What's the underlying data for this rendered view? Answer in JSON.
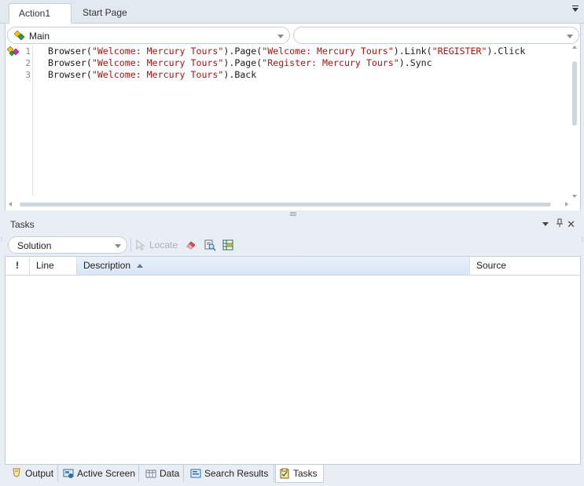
{
  "doc_tabs": [
    {
      "label": "Action1",
      "active": true
    },
    {
      "label": "Start Page",
      "active": false
    }
  ],
  "editor": {
    "scope_combo": {
      "value": "Main",
      "icon": "action-diamond-icon"
    },
    "member_combo": {
      "value": ""
    },
    "lines": [
      {
        "num": "1",
        "parts": [
          {
            "t": "Browser("
          },
          {
            "s": "\"Welcome: Mercury Tours\""
          },
          {
            "t": ").Page("
          },
          {
            "s": "\"Welcome: Mercury Tours\""
          },
          {
            "t": ").Link("
          },
          {
            "s": "\"REGISTER\""
          },
          {
            "t": ").Click"
          }
        ]
      },
      {
        "num": "2",
        "parts": [
          {
            "t": "Browser("
          },
          {
            "s": "\"Welcome: Mercury Tours\""
          },
          {
            "t": ").Page("
          },
          {
            "s": "\"Register: Mercury Tours\""
          },
          {
            "t": ").Sync"
          }
        ]
      },
      {
        "num": "3",
        "parts": [
          {
            "t": "Browser("
          },
          {
            "s": "\"Welcome: Mercury Tours\""
          },
          {
            "t": ").Back"
          }
        ]
      }
    ]
  },
  "tasks": {
    "title": "Tasks",
    "filter_value": "Solution",
    "toolbar": {
      "locate_label": "Locate"
    },
    "columns": {
      "bang": "!",
      "line": "Line",
      "description": "Description",
      "source": "Source"
    },
    "rows": []
  },
  "bottom_tabs": [
    {
      "label": "Output",
      "icon": "output-icon",
      "active": false
    },
    {
      "label": "Active Screen",
      "icon": "active-screen-icon",
      "active": false
    },
    {
      "label": "Data",
      "icon": "data-table-icon",
      "active": false
    },
    {
      "label": "Search Results",
      "icon": "search-results-icon",
      "active": false
    },
    {
      "label": "Tasks",
      "icon": "tasks-clipboard-icon",
      "active": true
    }
  ],
  "colors": {
    "string": "#a31515",
    "accent": "#d9e6f6"
  }
}
